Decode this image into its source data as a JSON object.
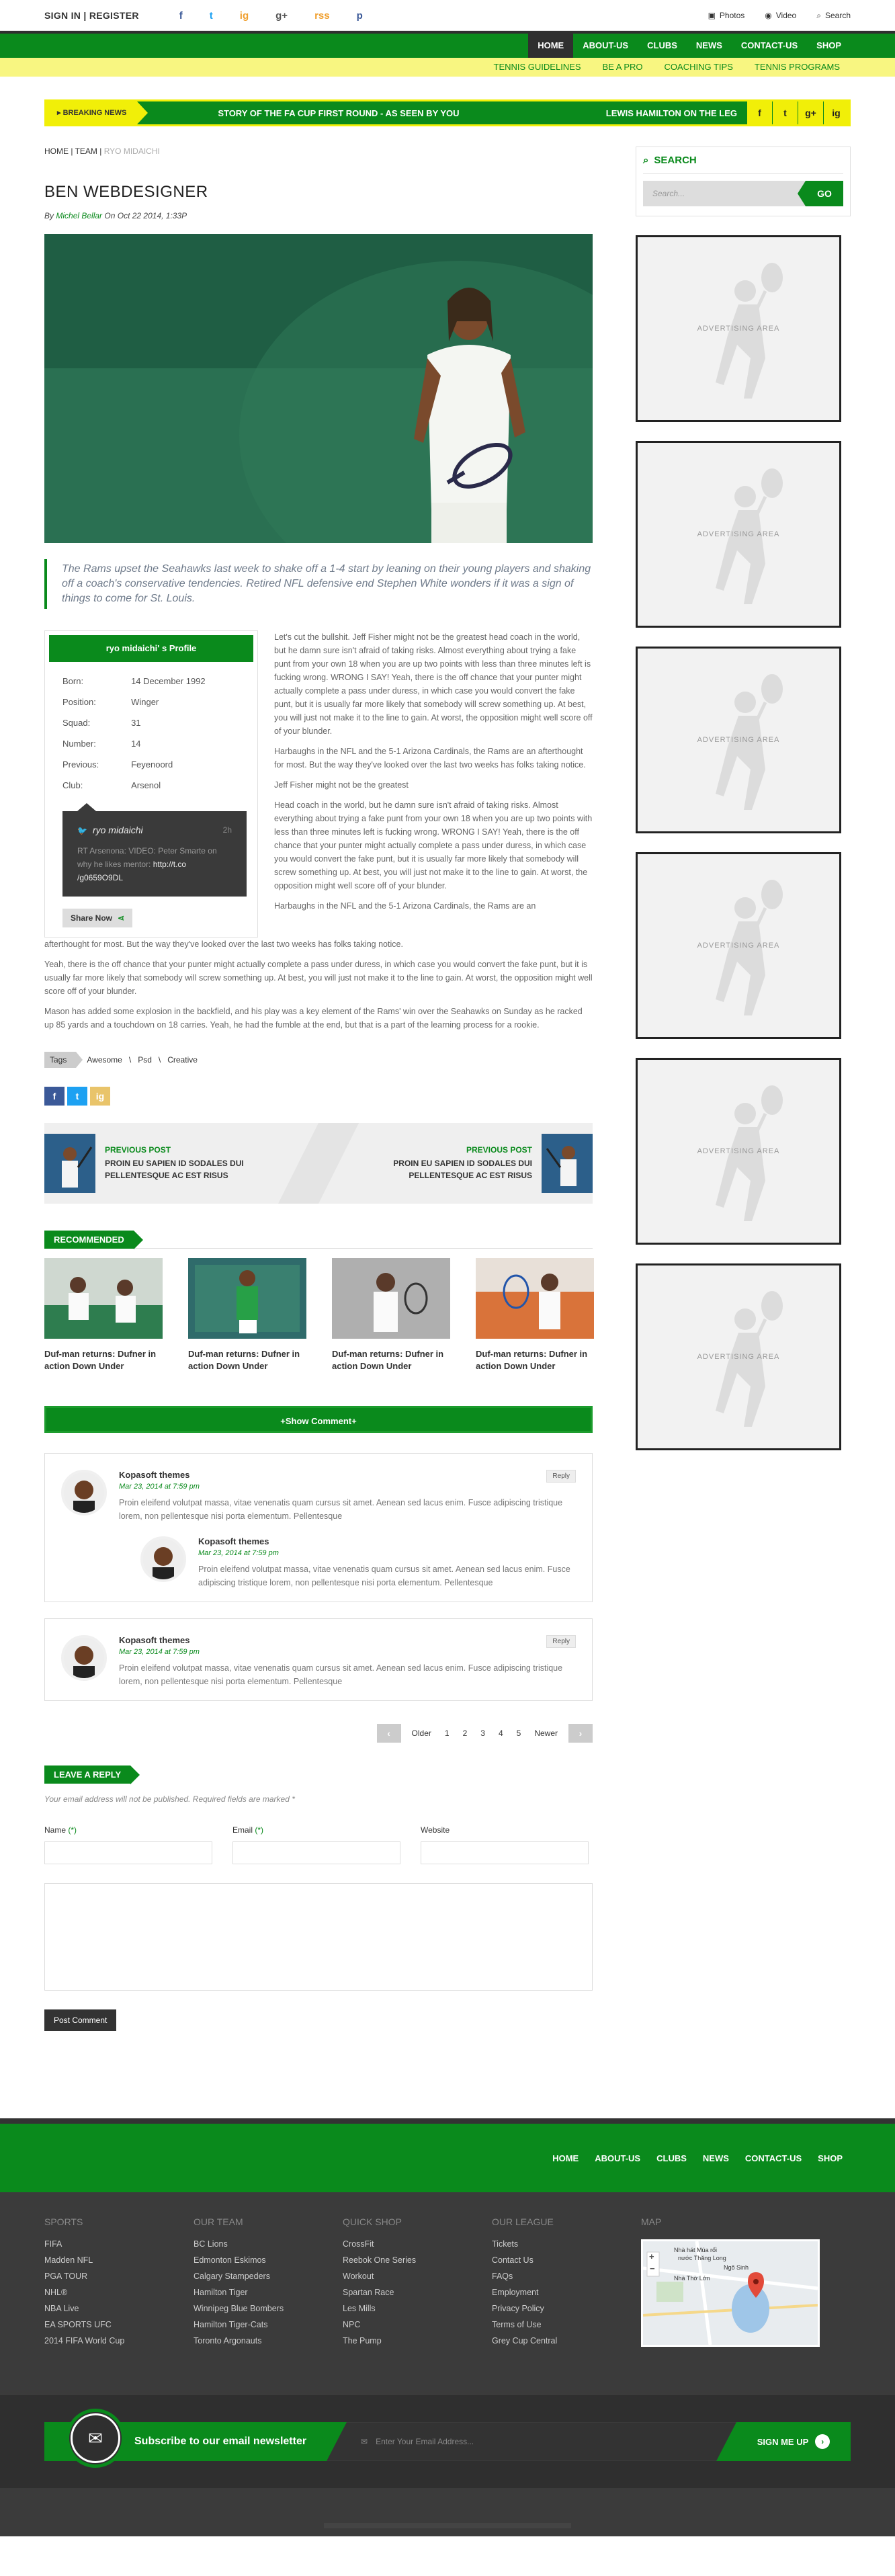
{
  "topbar": {
    "signin": "SIGN IN | REGISTER",
    "social": [
      "f",
      "t",
      "ig",
      "g+",
      "rss",
      "p"
    ],
    "links": [
      {
        "icon": "photo-icon",
        "label": "Photos"
      },
      {
        "icon": "video-icon",
        "label": "Video"
      },
      {
        "icon": "search-icon",
        "label": "Search"
      }
    ]
  },
  "nav": {
    "main": [
      "HOME",
      "ABOUT-US",
      "CLUBS",
      "NEWS",
      "CONTACT-US",
      "SHOP"
    ],
    "sub": [
      "TENNIS GUIDELINES",
      "BE A PRO",
      "COACHING TIPS",
      "TENNIS PROGRAMS"
    ]
  },
  "breaking": {
    "label": "BREAKING NEWS",
    "story1": "STORY OF THE FA CUP FIRST ROUND - AS SEEN BY YOU",
    "story2": "LEWIS HAMILTON ON THE LEG",
    "social": [
      "f",
      "t",
      "g+",
      "ig"
    ]
  },
  "article": {
    "breadcrumb": {
      "home": "HOME",
      "team": "TEAM",
      "current": "RYO MIDAICHI"
    },
    "title": "BEN WEBDESIGNER",
    "meta_by": "By",
    "meta_author": "Michel Bellar",
    "meta_date": "On Oct 22 2014, 1:33P",
    "quote": "The Rams upset the Seahawks last week to shake off a 1-4 start by leaning on their young players and shaking off a coach's conservative tendencies. Retired NFL defensive end Stephen White wonders if it was a sign of things to come for St. Louis.",
    "profile": {
      "heading": "ryo midaichi' s Profile",
      "rows": [
        [
          "Born:",
          "14 December 1992"
        ],
        [
          "Position:",
          "Winger"
        ],
        [
          "Squad:",
          "31"
        ],
        [
          "Number:",
          "14"
        ],
        [
          "Previous:",
          "Feyenoord"
        ],
        [
          "Club:",
          "Arsenol"
        ]
      ],
      "tweet_name": "ryo midaichi",
      "tweet_time": "2h",
      "tweet_text": "RT Arsenona: VIDEO: Peter Smarte on why he likes mentor:",
      "tweet_link": "http://t.co /g0659O9DL",
      "share": "Share Now"
    },
    "paragraphs": [
      "Let's cut the bullshit. Jeff Fisher might not be the greatest head coach in the world, but he damn sure isn't afraid of taking risks. Almost everything about trying a fake punt from your own 18 when you are up two points with less than three minutes left is fucking wrong. WRONG I SAY! Yeah, there is the off chance that your punter might actually complete a pass under duress, in which case you would convert the fake punt, but it is usually far more likely that somebody will screw something up. At best, you will just not make it to the line to gain. At worst, the opposition might well score off of your blunder.",
      "Harbaughs in the NFL and the 5-1 Arizona Cardinals, the Rams are an afterthought for most. But the way they've looked over the last two weeks has folks taking notice.",
      "Jeff Fisher might not be the greatest",
      "Head coach in the world, but he damn sure isn't afraid of taking risks. Almost everything about trying a fake punt from your own 18 when you are up two points with less than three minutes left is fucking wrong. WRONG I SAY! Yeah, there is the off chance that your punter might actually complete a pass under duress, in which case you would convert the fake punt, but it is usually far more likely that somebody will screw something up. At best, you will just not make it to the line to gain. At worst, the opposition might well score off of your blunder.",
      "Harbaughs in the NFL and the 5-1 Arizona Cardinals, the Rams are an"
    ],
    "full_paragraphs": [
      "afterthought for most. But the way they've looked over the last two weeks has folks taking notice.",
      "Yeah, there is the off chance that your punter might actually complete a pass under duress, in which case you would convert the fake punt, but it is usually far more likely that somebody will screw something up. At best, you will just not make it to the line to gain. At worst, the opposition might well score off of your blunder.",
      "Mason has added some explosion in the backfield, and his play was a key element of the Rams' win over the Seahawks on Sunday as he racked up 85 yards and a touchdown on 18 carries. Yeah, he had the fumble at the end, but that is a part of the learning process for a rookie."
    ],
    "tags_label": "Tags",
    "tags": [
      "Awesome",
      "Psd",
      "Creative"
    ],
    "share_buttons": [
      "f",
      "t",
      "ig"
    ]
  },
  "postnav": {
    "prev_label": "PREVIOUS POST",
    "prev_title": "PROIN EU SAPIEN ID SODALES DUI PELLENTESQUE AC EST RISUS",
    "next_label": "PREVIOUS POST",
    "next_title": "PROIN EU SAPIEN ID SODALES DUI PELLENTESQUE AC EST RISUS"
  },
  "recommended": {
    "heading": "RECOMMENDED",
    "items": [
      "Duf-man returns: Dufner in action Down Under",
      "Duf-man returns: Dufner in action Down Under",
      "Duf-man returns: Dufner in action Down Under",
      "Duf-man returns: Dufner in action Down Under"
    ]
  },
  "comments": {
    "show": "+Show Comment+",
    "reply": "Reply",
    "list": [
      {
        "name": "Kopasoft themes",
        "date": "Mar 23, 2014 at 7:59 pm",
        "text": "Proin eleifend volutpat massa, vitae venenatis quam cursus sit amet. Aenean sed lacus enim. Fusce adipiscing tristique lorem, non pellentesque nisi porta elementum. Pellentesque"
      },
      {
        "name": "Kopasoft themes",
        "date": "Mar 23, 2014 at 7:59 pm",
        "text": "Proin eleifend volutpat massa, vitae venenatis quam cursus sit amet. Aenean sed lacus enim. Fusce adipiscing tristique lorem, non pellentesque nisi porta elementum. Pellentesque"
      },
      {
        "name": "Kopasoft themes",
        "date": "Mar 23, 2014 at 7:59 pm",
        "text": "Proin eleifend volutpat massa, vitae venenatis quam cursus sit amet. Aenean sed lacus enim. Fusce adipiscing tristique lorem, non pellentesque nisi porta elementum. Pellentesque"
      }
    ]
  },
  "pager": {
    "older": "Older",
    "pages": [
      "1",
      "2",
      "3",
      "4",
      "5"
    ],
    "newer": "Newer"
  },
  "reply_form": {
    "heading": "LEAVE A REPLY",
    "note": "Your email address will not be published. Required fields are marked *",
    "name": "Name",
    "email": "Email",
    "website": "Website",
    "req": "(*)",
    "submit": "Post Comment"
  },
  "sidebar": {
    "search_title": "SEARCH",
    "search_placeholder": "Search...",
    "search_button": "GO",
    "ad_text": "ADVERTISING AREA"
  },
  "footer": {
    "nav": [
      "HOME",
      "ABOUT-US",
      "CLUBS",
      "NEWS",
      "CONTACT-US",
      "SHOP"
    ],
    "cols": [
      {
        "title": "SPORTS",
        "items": [
          "FIFA",
          "Madden NFL",
          "PGA TOUR",
          "NHL®",
          "NBA Live",
          "EA SPORTS UFC",
          "2014 FIFA World Cup"
        ]
      },
      {
        "title": "OUR TEAM",
        "items": [
          "BC Lions",
          "Edmonton Eskimos",
          "Calgary Stampeders",
          "Hamilton Tiger",
          "Winnipeg Blue Bombers",
          "Hamilton Tiger-Cats",
          "Toronto Argonauts"
        ]
      },
      {
        "title": "QUICK SHOP",
        "items": [
          "CrossFit",
          "Reebok One Series",
          "Workout",
          "Spartan Race",
          "Les Mills",
          "NPC",
          "The Pump"
        ]
      },
      {
        "title": "OUR LEAGUE",
        "items": [
          "Tickets",
          "Contact Us",
          "FAQs",
          "Employment",
          "Privacy Policy",
          "Terms of Use",
          "Grey Cup Central"
        ]
      }
    ],
    "map_title": "MAP",
    "map_labels": [
      "Nhà hát Múa rối",
      "nước Thăng Long",
      "Nhà Thờ Lớn",
      "Ngõ Sinh"
    ],
    "newsletter": "Subscribe to our email newsletter",
    "email_placeholder": "Enter Your Email Address...",
    "signup": "SIGN ME UP"
  },
  "colors": {
    "green": "#0a8a1c",
    "yellow": "#f1ef08",
    "dark": "#333333"
  }
}
